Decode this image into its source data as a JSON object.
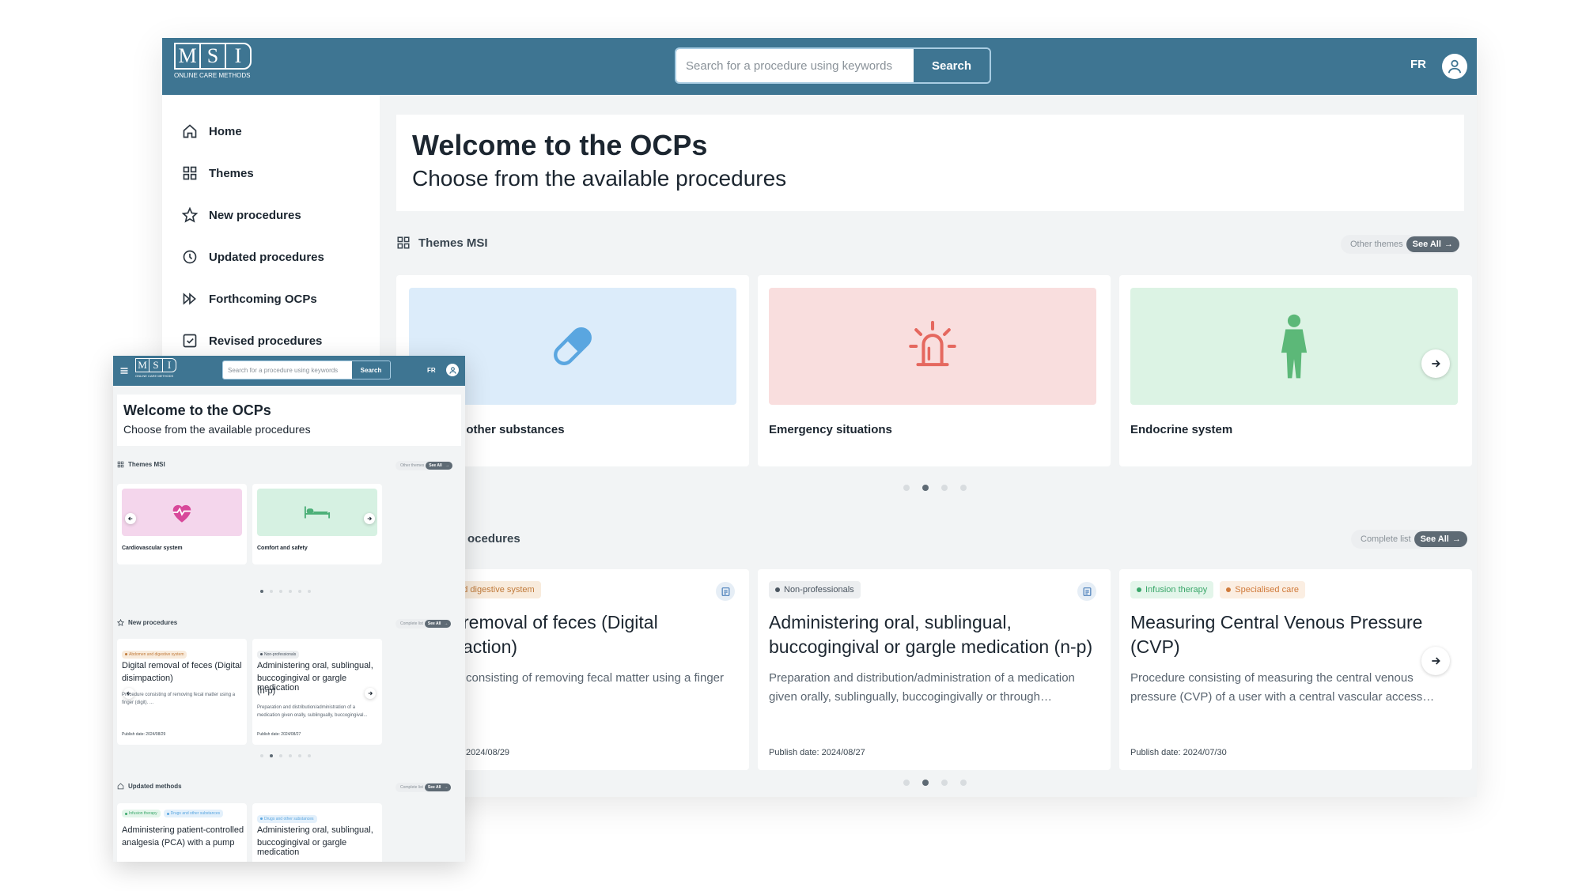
{
  "app": {
    "logo_letters": [
      "M",
      "S",
      "I"
    ],
    "logo_subtitle": "ONLINE CARE METHODS",
    "search_placeholder": "Search for a procedure using keywords",
    "search_button": "Search",
    "language": "FR"
  },
  "sidebar": {
    "items": [
      {
        "label": "Home",
        "icon": "home-icon"
      },
      {
        "label": "Themes",
        "icon": "grid-icon"
      },
      {
        "label": "New procedures",
        "icon": "star-icon"
      },
      {
        "label": "Updated procedures",
        "icon": "clock-icon"
      },
      {
        "label": "Forthcoming OCPs",
        "icon": "fast-forward-icon"
      },
      {
        "label": "Revised procedures",
        "icon": "check-square-icon"
      }
    ]
  },
  "welcome": {
    "title": "Welcome to the OCPs",
    "subtitle": "Choose from the available procedures"
  },
  "themes": {
    "heading": "Themes MSI",
    "other_label": "Other themes",
    "see_all": "See All",
    "cards": [
      {
        "title": "Drugs and other substances",
        "visible_title": "l other substances",
        "icon": "pill-icon",
        "bg": "#dcecfa",
        "color": "#5aa6e0"
      },
      {
        "title": "Emergency situations",
        "visible_title": "Emergency situations",
        "icon": "siren-icon",
        "bg": "#f9dede",
        "color": "#e5685f"
      },
      {
        "title": "Endocrine system",
        "visible_title": "Endocrine system",
        "icon": "body-icon",
        "bg": "#dcf3e4",
        "color": "#5cb878"
      }
    ]
  },
  "new_procedures": {
    "heading_visible": "ocedures",
    "complete_label": "Complete list",
    "see_all": "See All",
    "cards": [
      {
        "tags": [
          {
            "label": "and digestive system",
            "color": "#c07a3a",
            "bg": "#f8ebdc"
          }
        ],
        "title_lines": [
          "removal of feces (Digital",
          "action)"
        ],
        "desc_lines": [
          "consisting of removing fecal matter using a finger"
        ],
        "date": "2024/08/29"
      },
      {
        "tags": [
          {
            "label": "Non-professionals",
            "color": "#4a5560",
            "bg": "#eceef0"
          }
        ],
        "title_lines": [
          "Administering oral, sublingual,",
          "buccogingival or gargle medication (n-p)"
        ],
        "desc_lines": [
          "Preparation and distribution/administration of a medication",
          "given orally, sublingually, buccogingivally or through…"
        ],
        "date": "Publish date: 2024/08/27"
      },
      {
        "tags": [
          {
            "label": "Infusion therapy",
            "color": "#3aa76a",
            "bg": "#e3f5ea"
          },
          {
            "label": "Specialised care",
            "color": "#d07a3a",
            "bg": "#fbeee2"
          }
        ],
        "title_lines": [
          "Measuring Central Venous Pressure",
          "(CVP)"
        ],
        "desc_lines": [
          "Procedure consisting of measuring the central venous",
          "pressure (CVP) of a user with a central vascular access…"
        ],
        "date": "Publish date: 2024/07/30"
      }
    ]
  },
  "mobile": {
    "welcome_title": "Welcome to the OCPs",
    "welcome_subtitle": "Choose from the available procedures",
    "themes_heading": "Themes MSI",
    "themes_other": "Other themes",
    "see_all": "See All",
    "theme_cards": [
      {
        "title": "Cardiovascular system",
        "icon": "heart-icon",
        "bg": "#f4d6ec",
        "color": "#d8489a"
      },
      {
        "title": "Comfort and safety",
        "icon": "bed-icon",
        "bg": "#d6f1e2",
        "color": "#4cb078"
      }
    ],
    "new_heading": "New procedures",
    "complete_label": "Complete list",
    "new_cards": [
      {
        "tag": "Abdomen and digestive system",
        "tag_color": "#c07a3a",
        "tag_bg": "#f8ebdc",
        "title_lines": [
          "Digital removal of feces (Digital",
          "disimpaction)"
        ],
        "desc_lines": [
          "Procedure consisting of removing fecal matter using a",
          "finger (digit). ..."
        ],
        "date": "Publish date: 2024/08/29"
      },
      {
        "tag": "Non-professionals",
        "tag_color": "#4a5560",
        "tag_bg": "#eceef0",
        "title_lines": [
          "Administering oral, sublingual,",
          "buccogingival or gargle medication",
          "(n-p)"
        ],
        "desc_lines": [
          "Preparation and distribution/administration of a",
          "medication given orally, sublingually, buccogingival..."
        ],
        "date": "Publish date: 2024/08/27"
      }
    ],
    "updated_heading": "Updated methods",
    "updated_cards": [
      {
        "tags": [
          "Infusion therapy",
          "Drugs and other substances"
        ],
        "title_lines": [
          "Administering patient-controlled",
          "analgesia (PCA) with a pump"
        ]
      },
      {
        "tags": [
          "Drugs and other substances"
        ],
        "title_lines": [
          "Administering oral, sublingual,",
          "buccogingival or gargle medication"
        ]
      }
    ]
  }
}
